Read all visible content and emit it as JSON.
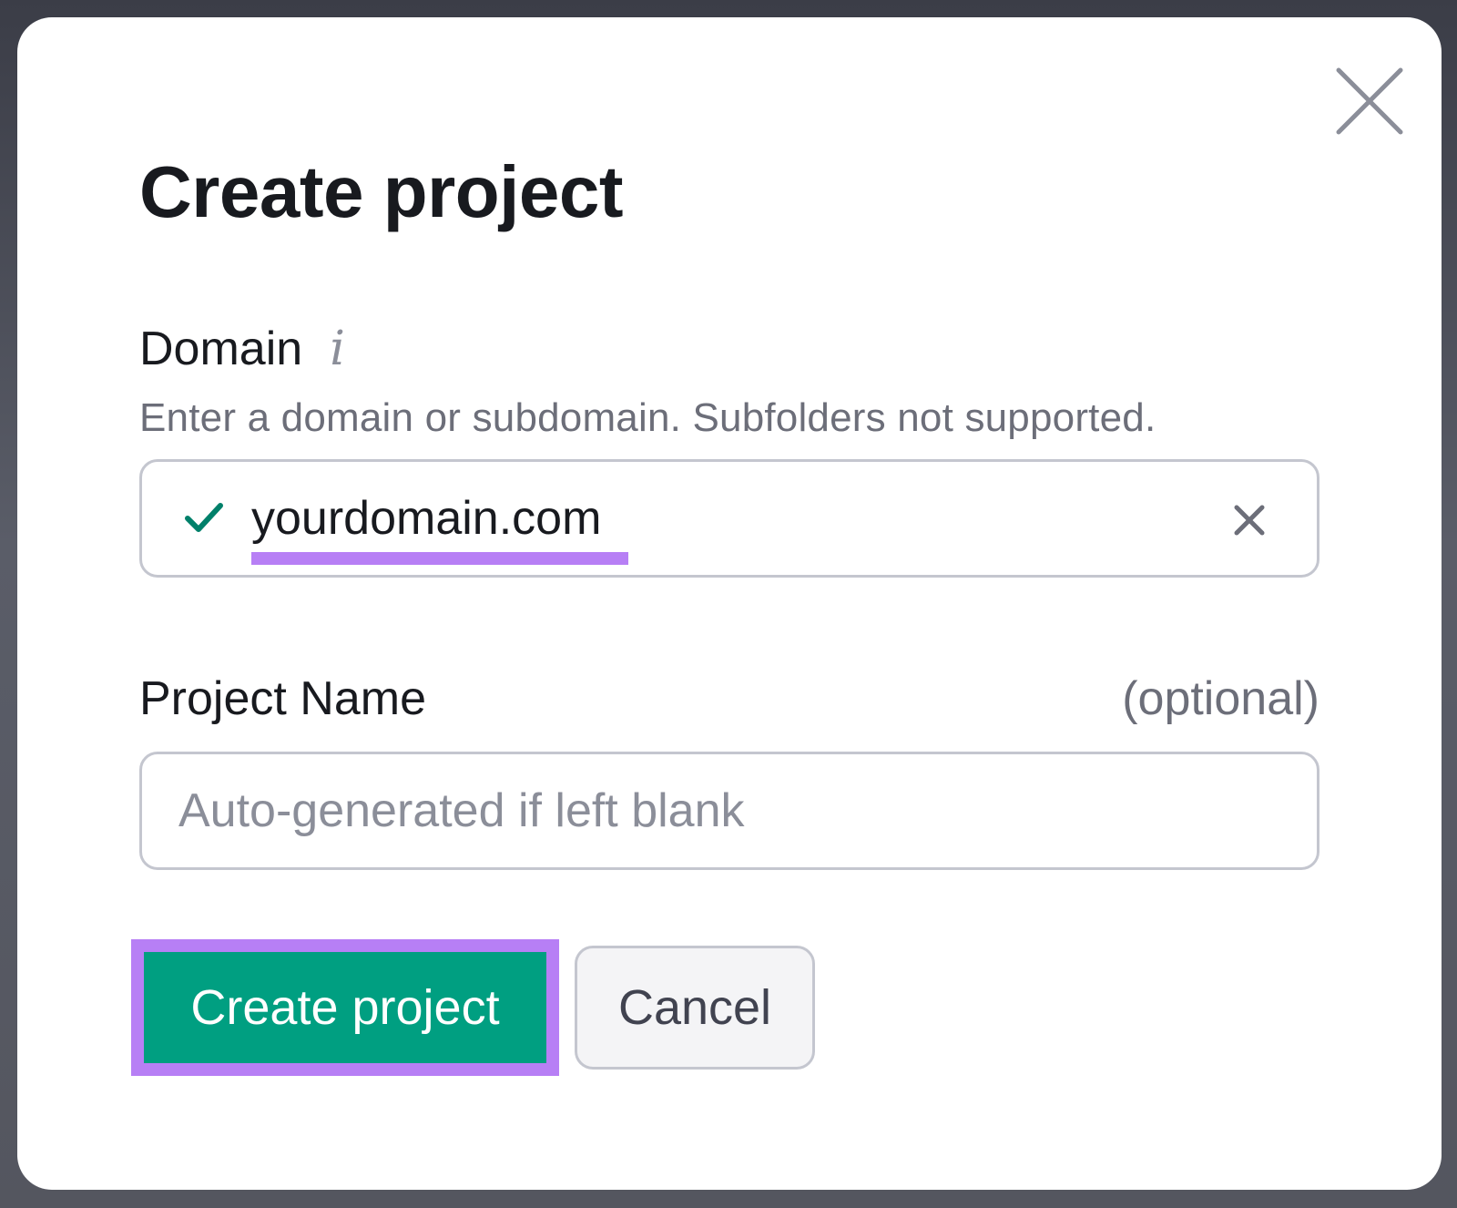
{
  "dialog": {
    "title": "Create project",
    "close_icon": "close-icon"
  },
  "domain": {
    "label": "Domain",
    "info_icon": "info-icon",
    "info_glyph": "i",
    "hint": "Enter a domain or subdomain. Subfolders not supported.",
    "value": "yourdomain.com",
    "status_icon": "check-icon",
    "clear_icon": "clear-icon"
  },
  "project_name": {
    "label": "Project Name",
    "optional_label": "(optional)",
    "value": "",
    "placeholder": "Auto-generated if left blank"
  },
  "actions": {
    "create_label": "Create project",
    "cancel_label": "Cancel"
  },
  "colors": {
    "primary_button": "#009f81",
    "highlight": "#b77ff5",
    "check": "#00806a",
    "text": "#181a1f",
    "muted_text": "#6c6e79"
  }
}
